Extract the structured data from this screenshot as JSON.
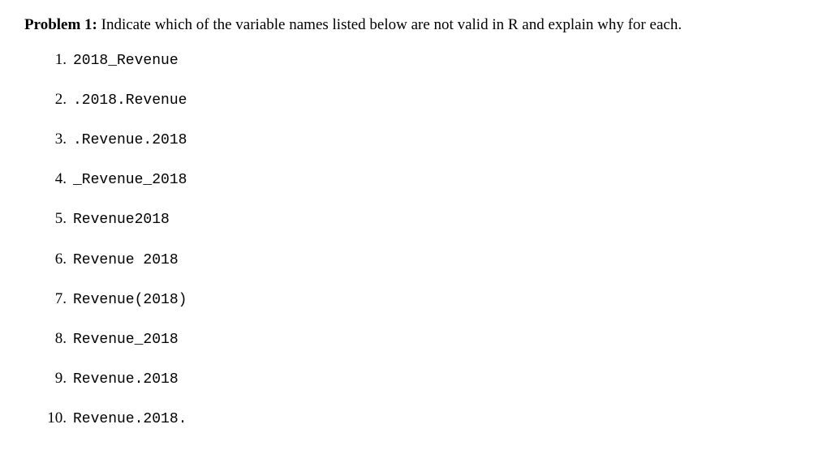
{
  "problem": {
    "label": "Problem 1:",
    "text": " Indicate which of the variable names listed below are not valid in R and explain why for each."
  },
  "items": [
    {
      "marker": "1.",
      "code": "2018_Revenue"
    },
    {
      "marker": "2.",
      "code": ".2018.Revenue"
    },
    {
      "marker": "3.",
      "code": ".Revenue.2018"
    },
    {
      "marker": "4.",
      "code": "_Revenue_2018"
    },
    {
      "marker": "5.",
      "code": "Revenue2018"
    },
    {
      "marker": "6.",
      "code": "Revenue 2018"
    },
    {
      "marker": "7.",
      "code": "Revenue(2018)"
    },
    {
      "marker": "8.",
      "code": "Revenue_2018"
    },
    {
      "marker": "9.",
      "code": "Revenue.2018"
    },
    {
      "marker": "10.",
      "code": "Revenue.2018."
    }
  ]
}
